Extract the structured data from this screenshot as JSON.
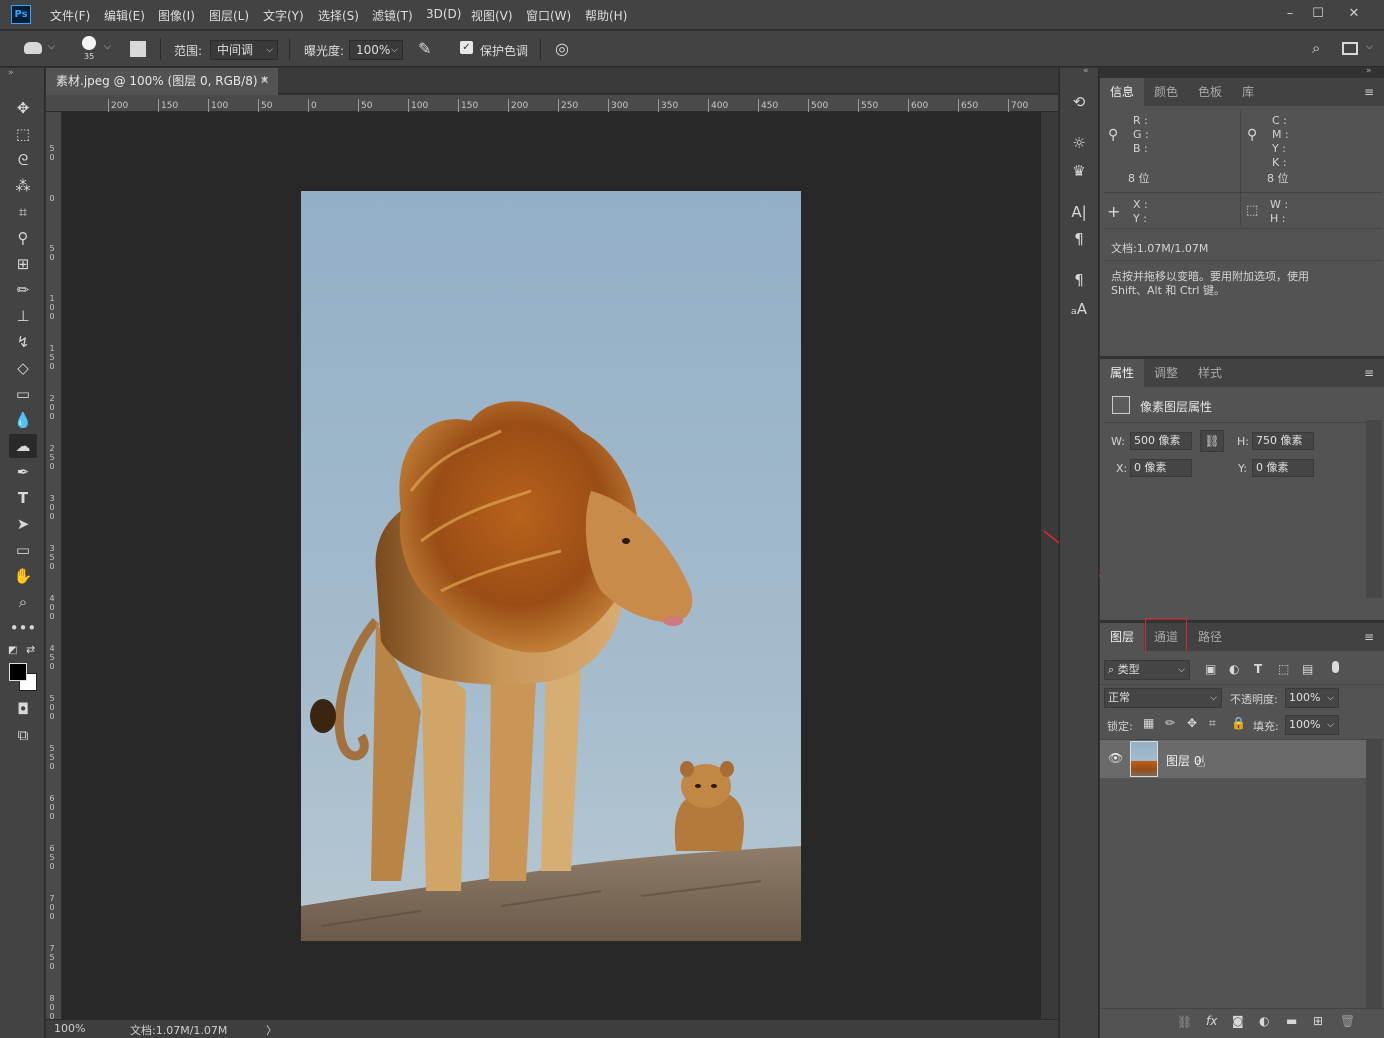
{
  "menubar": {
    "app_icon": "Ps",
    "items": [
      "文件(F)",
      "编辑(E)",
      "图像(I)",
      "图层(L)",
      "文字(Y)",
      "选择(S)",
      "滤镜(T)",
      "3D(D)",
      "视图(V)",
      "窗口(W)",
      "帮助(H)"
    ],
    "window_buttons": [
      "minimize-icon",
      "maximize-icon",
      "close-icon"
    ]
  },
  "options": {
    "brush_size": "35",
    "range_label": "范围:",
    "range_value": "中间调",
    "exposure_label": "曝光度:",
    "exposure_value": "100%",
    "protect_tones_label": "保护色调",
    "protect_tones_checked": true
  },
  "document": {
    "tab_title": "素材.jpeg @ 100% (图层 0, RGB/8) *",
    "zoom": "100%",
    "doc_size": "文档:1.07M/1.07M"
  },
  "ruler": {
    "h_ticks": [
      "200",
      "150",
      "100",
      "50",
      "0",
      "50",
      "100",
      "150",
      "200",
      "250",
      "300",
      "350",
      "400",
      "450",
      "500",
      "550",
      "600",
      "650",
      "700"
    ],
    "v_ticks": [
      "50",
      "0",
      "50",
      "100",
      "150",
      "200",
      "250",
      "300",
      "350",
      "400",
      "450",
      "500",
      "550",
      "600",
      "650",
      "700",
      "750",
      "800"
    ]
  },
  "info_panel": {
    "tabs": [
      "信息",
      "颜色",
      "色板",
      "库"
    ],
    "rgb_labels": [
      "R :",
      "G :",
      "B :"
    ],
    "cmyk_labels": [
      "C :",
      "M :",
      "Y :",
      "K :"
    ],
    "bit_left": "8 位",
    "bit_right": "8 位",
    "xy_labels": [
      "X :",
      "Y :"
    ],
    "wh_labels": [
      "W :",
      "H :"
    ],
    "doc_size": "文档:1.07M/1.07M",
    "hint_line1": "点按并拖移以变暗。要用附加选项，使用",
    "hint_line2": "Shift、Alt 和 Ctrl 键。"
  },
  "properties_panel": {
    "tabs": [
      "属性",
      "调整",
      "样式"
    ],
    "title": "像素图层属性",
    "w_label": "W:",
    "w_value": "500 像素",
    "h_label": "H:",
    "h_value": "750 像素",
    "x_label": "X:",
    "x_value": "0 像素",
    "y_label": "Y:",
    "y_value": "0 像素"
  },
  "layers_panel": {
    "tabs": [
      "图层",
      "通道",
      "路径"
    ],
    "filter_kind": "类型",
    "blend_mode": "正常",
    "opacity_label": "不透明度:",
    "opacity_value": "100%",
    "lock_label": "锁定:",
    "fill_label": "填充:",
    "fill_value": "100%",
    "layers": [
      {
        "name": "图层 0",
        "visible": true
      }
    ]
  },
  "colors": {
    "accent_blue": "#31a8ff",
    "highlight_red": "#e0262c",
    "panel_bg": "#535353",
    "canvas_bg": "#282828"
  }
}
